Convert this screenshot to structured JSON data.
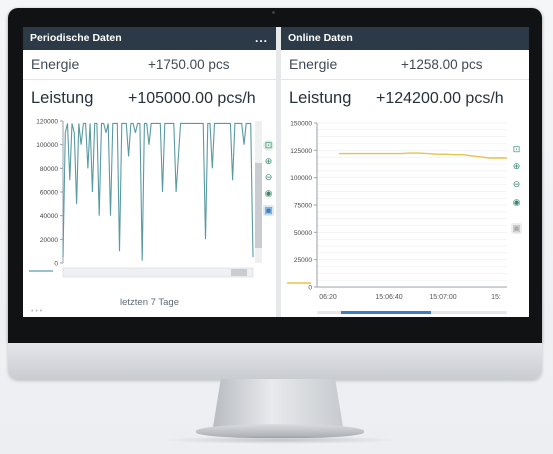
{
  "left_panel": {
    "title": "Periodische Daten",
    "more_label": "...",
    "energy": {
      "label": "Energie",
      "value": "+1750.00 pcs"
    },
    "power": {
      "label": "Leistung",
      "value": "+105000.00 pcs/h"
    },
    "footer_label": "letzten 7 Tage",
    "scroll_left": "‹",
    "scroll_right": "›"
  },
  "right_panel": {
    "title": "Online Daten",
    "energy": {
      "label": "Energie",
      "value": "+1258.00 pcs"
    },
    "power": {
      "label": "Leistung",
      "value": "+124200.00 pcs/h"
    }
  },
  "chart_data": [
    {
      "type": "line",
      "ylim": [
        0,
        120000
      ],
      "yticks": [
        "120000",
        "100000",
        "80000",
        "60000",
        "40000",
        "20000",
        "0"
      ],
      "series": [
        {
          "color": "#5a9aa3",
          "values": [
            5000,
            110000,
            118000,
            70000,
            118000,
            110000,
            50000,
            118000,
            100000,
            118000,
            118000,
            80000,
            118000,
            60000,
            118000,
            118000,
            40000,
            118000,
            118000,
            110000,
            118000,
            40000,
            118000,
            118000,
            118000,
            10000,
            118000,
            118000,
            118000,
            90000,
            118000,
            118000,
            110000,
            118000,
            118000,
            2000,
            118000,
            118000,
            100000,
            118000,
            118000,
            118000,
            118000,
            118000,
            60000,
            118000,
            118000,
            118000,
            118000,
            118000,
            60000,
            90000,
            118000,
            118000,
            118000,
            118000,
            118000,
            118000,
            118000,
            118000,
            118000,
            118000,
            118000,
            20000,
            118000,
            118000,
            80000,
            118000,
            118000,
            118000,
            118000,
            118000,
            118000,
            118000,
            118000,
            70000,
            118000,
            118000,
            118000,
            118000,
            100000,
            118000,
            118000,
            118000,
            5000
          ]
        }
      ]
    },
    {
      "type": "line",
      "ylim": [
        0,
        150000
      ],
      "yticks": [
        "150000",
        "125000",
        "100000",
        "75000",
        "50000",
        "25000",
        "0"
      ],
      "xticks": [
        "06:20",
        "15:06:40",
        "15:07:00",
        "15:"
      ],
      "series": [
        {
          "color": "#e8c24a",
          "values": [
            122000,
            122000,
            122000,
            122000,
            122000,
            122000,
            122000,
            122000,
            122500,
            122500,
            122000,
            121500,
            121500,
            121000,
            121000,
            120000,
            119000,
            118000,
            118000,
            118000
          ]
        }
      ]
    }
  ],
  "icons": {
    "zoom_rect": "zoom-region-icon",
    "zoom_in": "zoom-in-icon",
    "zoom_out": "zoom-out-icon",
    "pan": "pan-icon",
    "export": "export-icon"
  }
}
